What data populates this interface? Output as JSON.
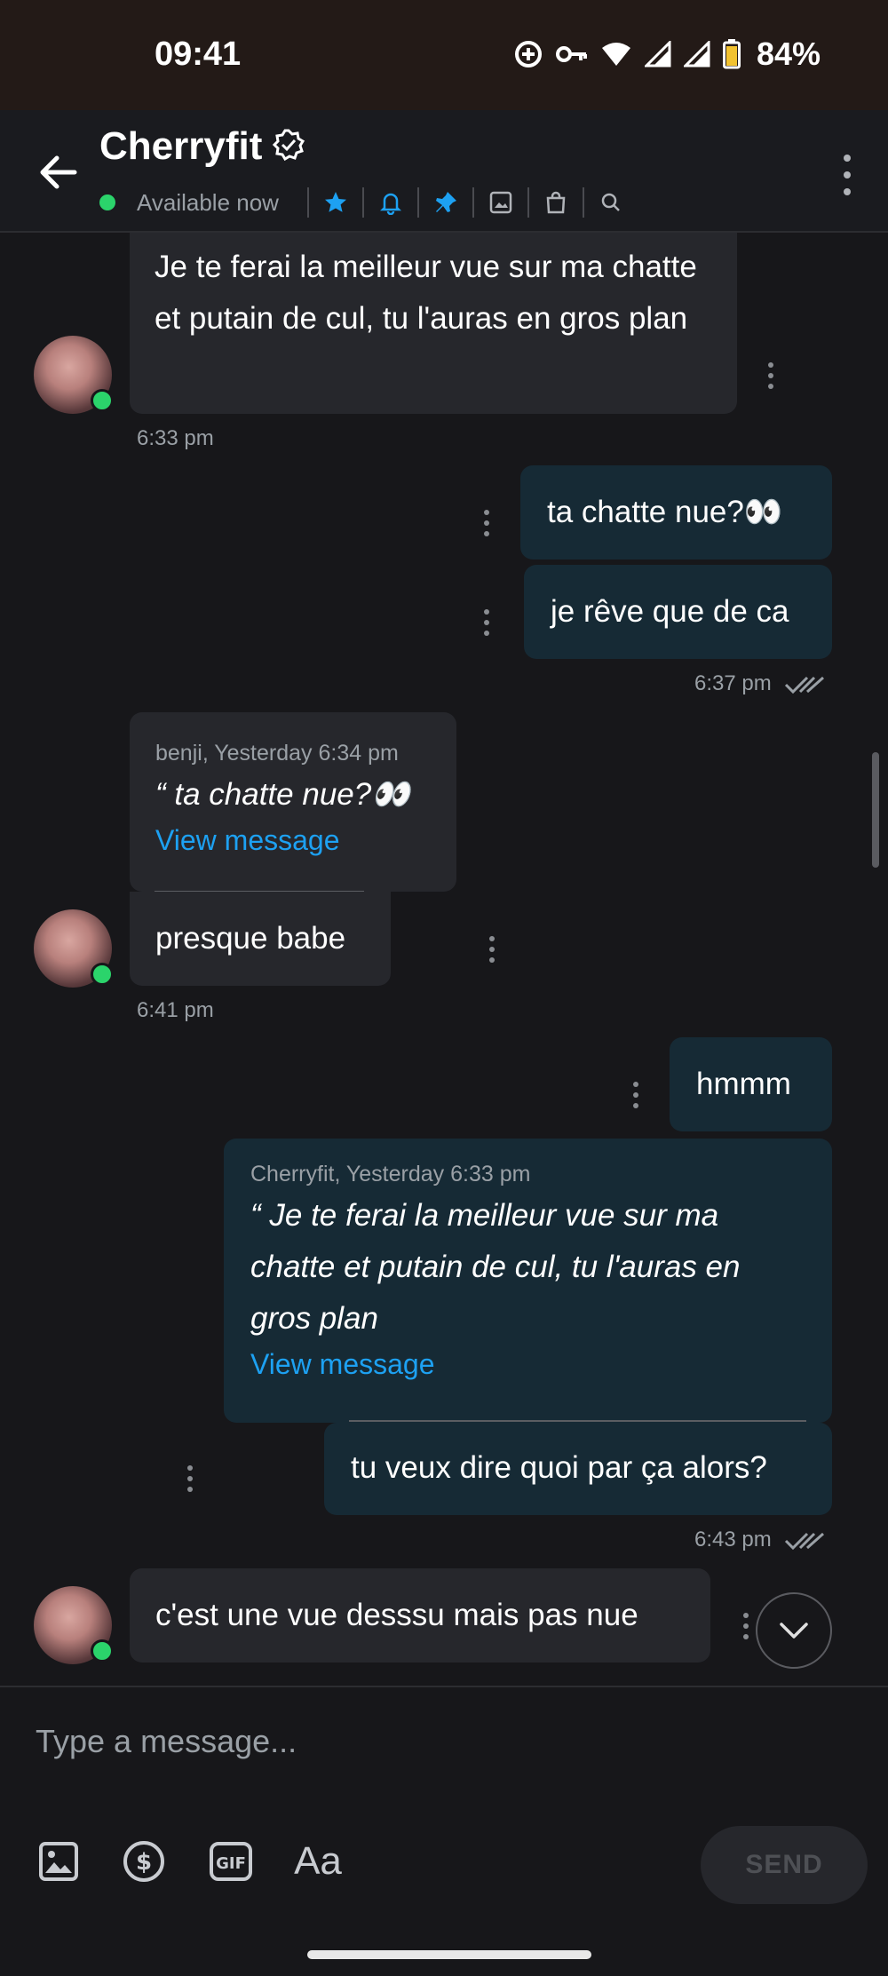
{
  "status_bar": {
    "time": "09:41",
    "battery": "84%"
  },
  "header": {
    "title": "Cherryfit",
    "availability": "Available now",
    "colors": {
      "accent": "#1da1f2",
      "online": "#2bd46b"
    }
  },
  "messages": [
    {
      "side": "in",
      "text": "Je te ferai la meilleur vue sur ma chatte et putain de cul, tu l'auras en gros plan",
      "time": "6:33 pm"
    },
    {
      "side": "out",
      "text": "ta chatte nue?👀"
    },
    {
      "side": "out",
      "text": "je rêve que de ca",
      "time": "6:37 pm"
    },
    {
      "side": "in",
      "quote": {
        "meta": "benji, Yesterday 6:34 pm",
        "text": "“ ta chatte nue?👀",
        "link": "View message"
      },
      "text": "presque babe",
      "time": "6:41 pm"
    },
    {
      "side": "out",
      "text": "hmmm"
    },
    {
      "side": "out",
      "quote": {
        "meta": "Cherryfit, Yesterday 6:33 pm",
        "text": "“ Je te ferai la meilleur vue sur ma chatte et putain de cul, tu l'auras en gros plan",
        "link": "View message"
      },
      "text": "tu veux dire quoi par ça alors?",
      "time": "6:43 pm"
    },
    {
      "side": "in",
      "text": "c'est une vue desssu mais pas nue"
    }
  ],
  "composer": {
    "placeholder": "Type a message...",
    "gif_label": "GIF",
    "format_label": "Aa",
    "send_label": "SEND"
  }
}
